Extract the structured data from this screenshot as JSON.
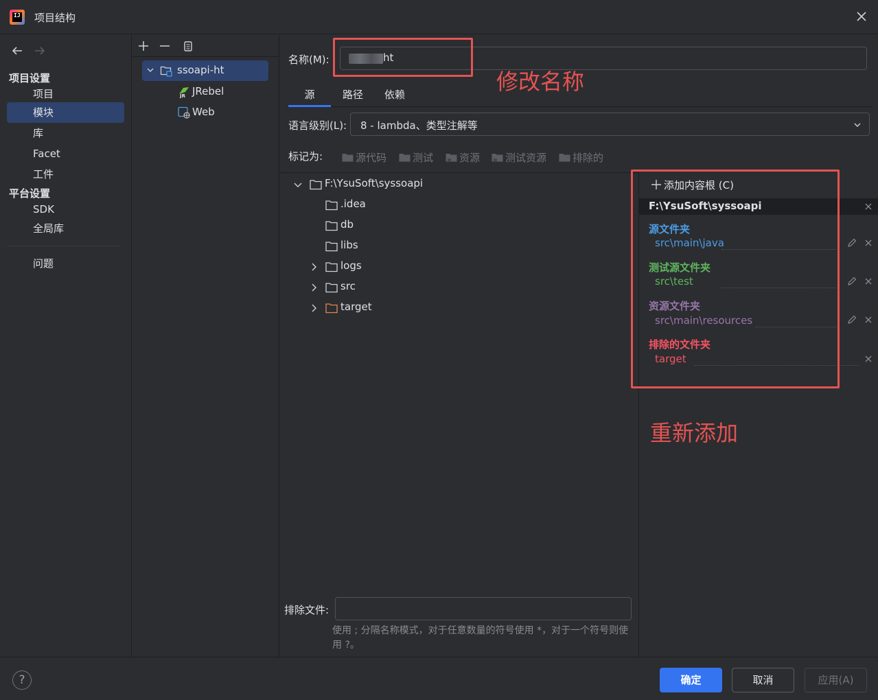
{
  "window": {
    "title": "项目结构"
  },
  "sidebar": {
    "project_settings": "项目设置",
    "project_items": [
      "项目",
      "模块",
      "库",
      "Facet",
      "工件"
    ],
    "platform_settings": "平台设置",
    "platform_items": [
      "SDK",
      "全局库"
    ],
    "problems": "问题",
    "selected": "模块"
  },
  "module_tree": {
    "module": "ssoapi-ht",
    "facets": [
      "JRebel",
      "Web"
    ]
  },
  "main": {
    "name_label": "名称(M):",
    "name_value_suffix": "ht",
    "tabs": [
      "源",
      "路径",
      "依赖"
    ],
    "active_tab": "源",
    "language_level_label": "语言级别(L):",
    "language_level_value": "8 - lambda、类型注解等",
    "mark_as_label": "标记为:",
    "mark_buttons": [
      "源代码",
      "测试",
      "资源",
      "测试资源",
      "排除的"
    ],
    "dir_tree": {
      "root": "F:\\YsuSoft\\syssoapi",
      "children": [
        ".idea",
        "db",
        "libs",
        "logs",
        "src",
        "target"
      ]
    },
    "exclude_files_label": "排除文件:",
    "exclude_files_hint": "使用 ; 分隔名称模式，对于任意数量的符号使用 *，对于一个符号则使用 ?。"
  },
  "content_roots": {
    "add_label": "添加内容根 (C)",
    "root_path": "F:\\YsuSoft\\syssoapi",
    "categories": [
      {
        "title": "源文件夹",
        "path": "src\\main\\java",
        "color": "#4e9de6"
      },
      {
        "title": "测试源文件夹",
        "path": "src\\test",
        "color": "#5fb65f"
      },
      {
        "title": "资源文件夹",
        "path": "src\\main\\resources",
        "color": "#9876aa"
      },
      {
        "title": "排除的文件夹",
        "path": "target",
        "color": "#f75464"
      }
    ]
  },
  "annotations": {
    "rename": "修改名称",
    "readd": "重新添加"
  },
  "footer": {
    "help": "?",
    "ok": "确定",
    "cancel": "取消",
    "apply": "应用(A)"
  },
  "colors": {
    "accent": "#3574f0",
    "selection": "#2e436e",
    "annotation_red": "#e55353"
  }
}
